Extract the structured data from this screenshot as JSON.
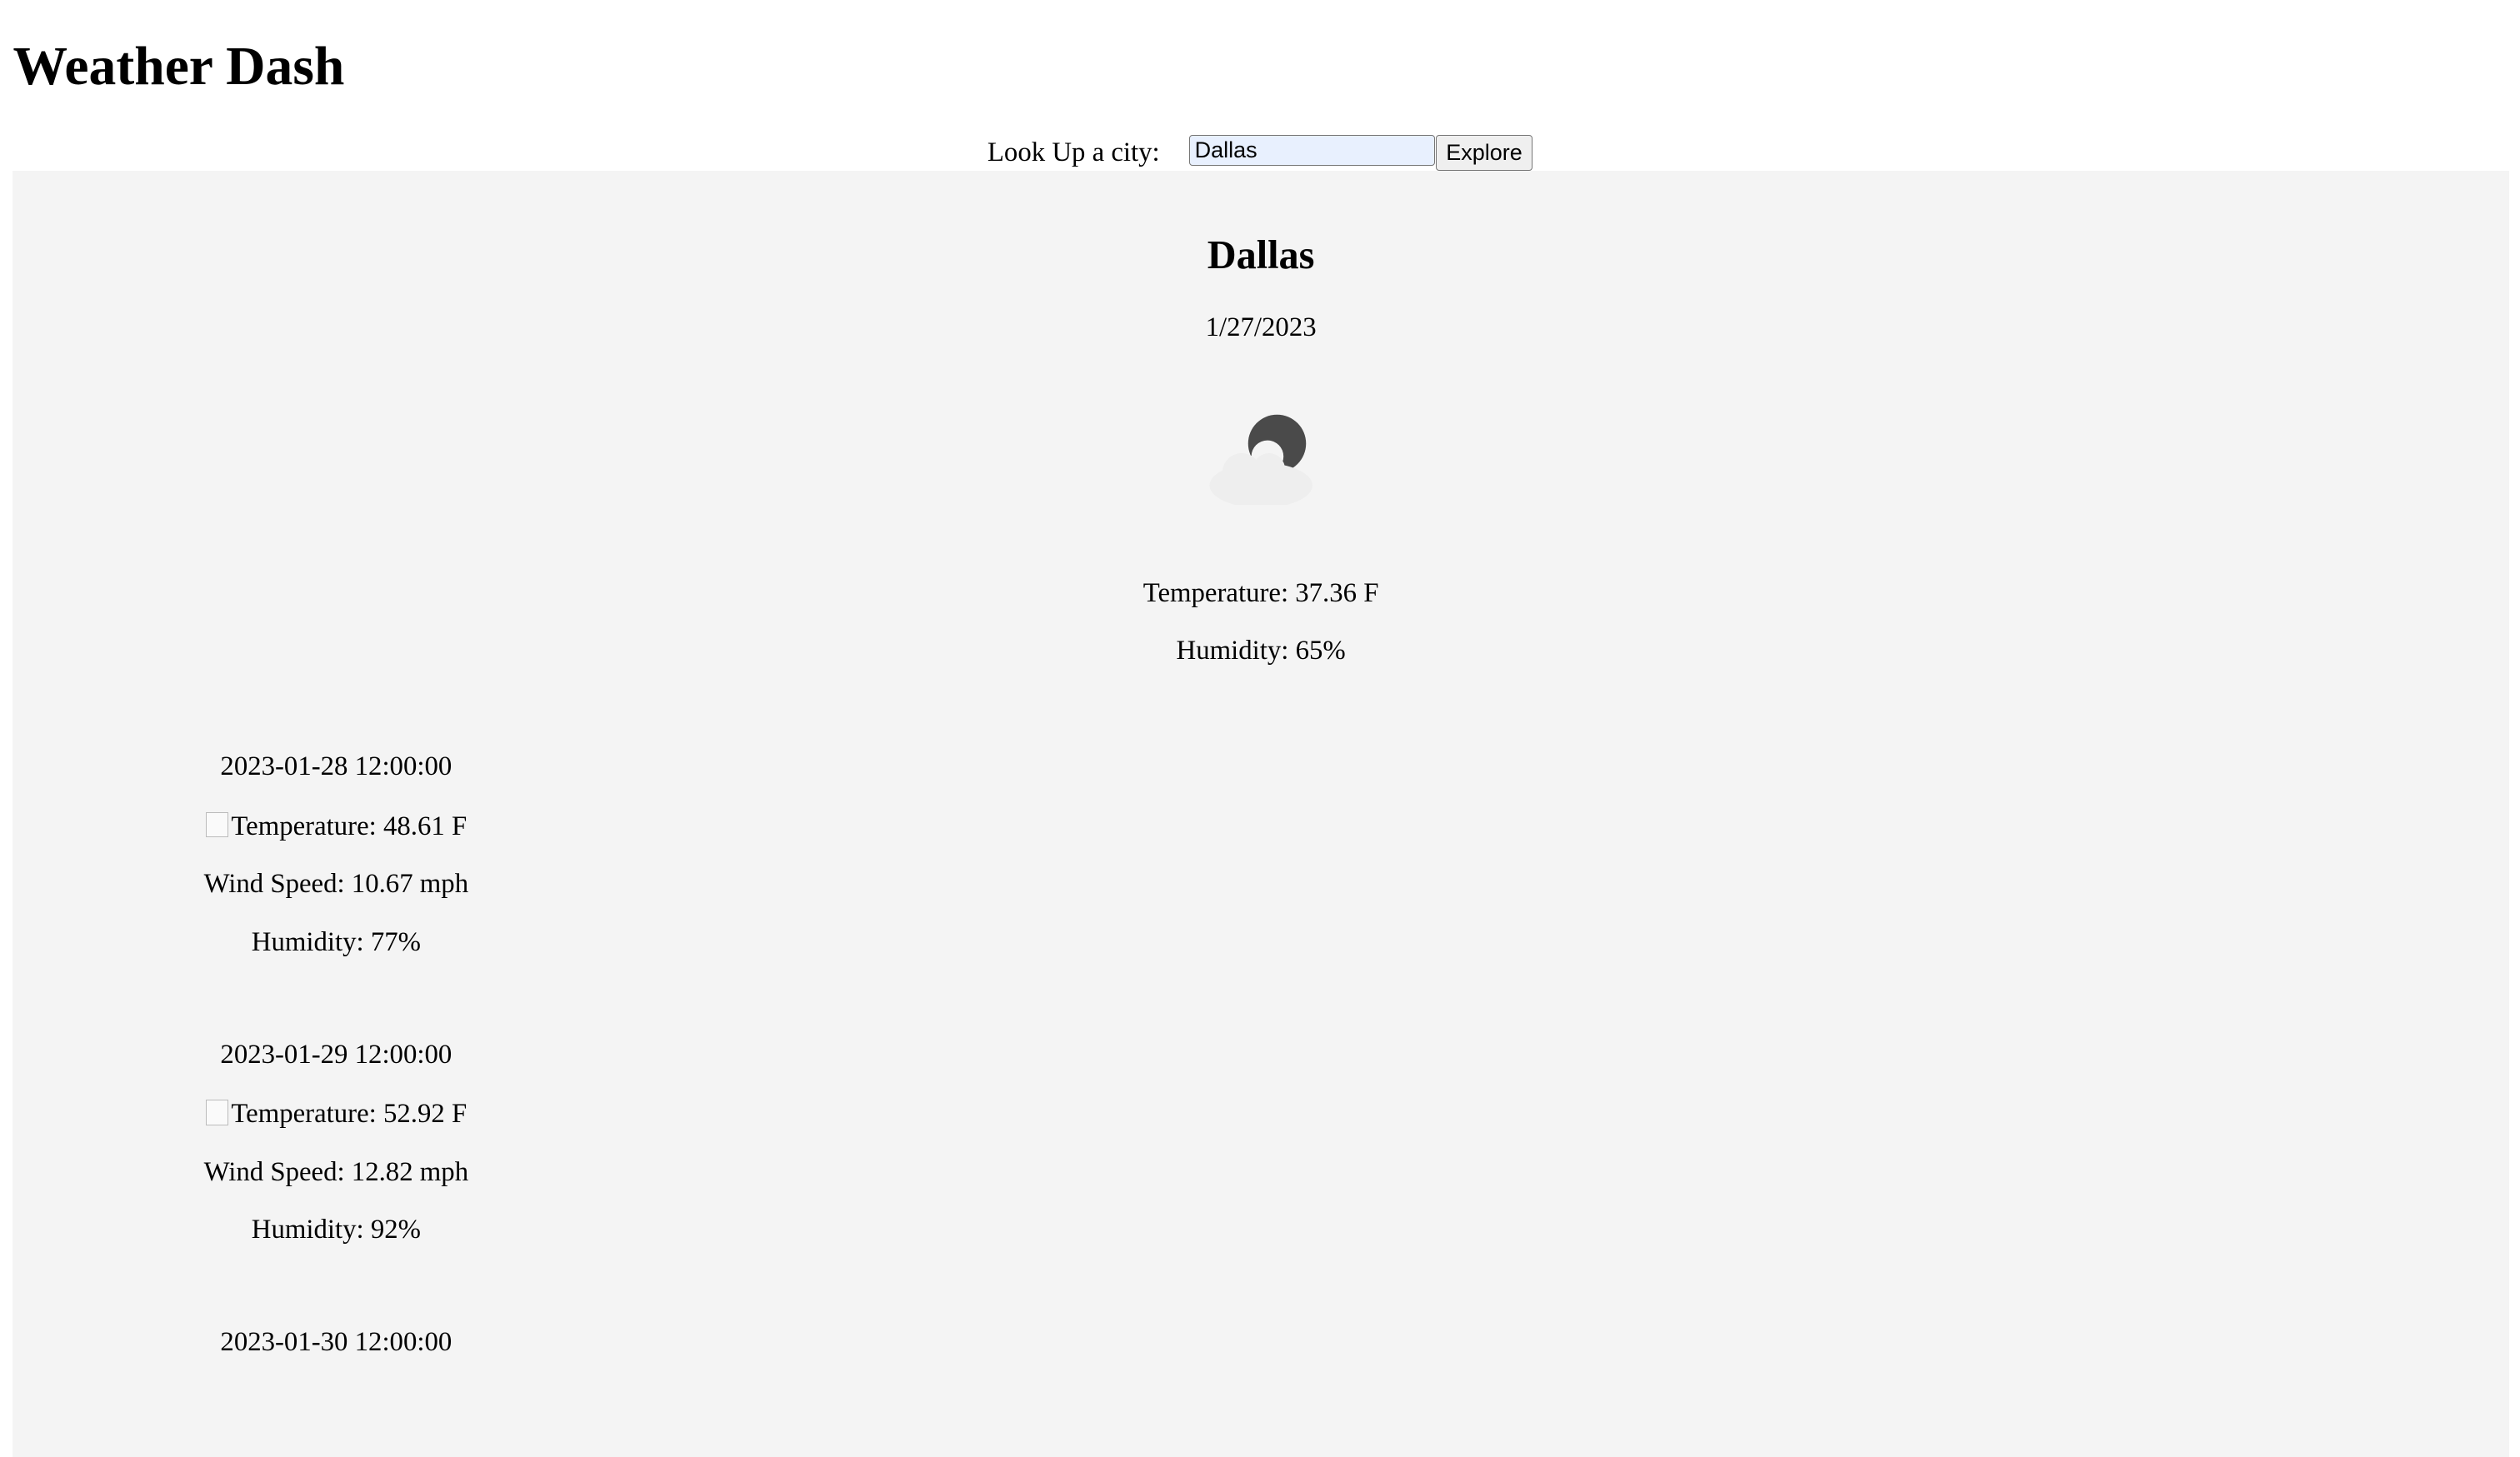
{
  "app": {
    "title": "Weather Dash"
  },
  "search": {
    "label": "Look Up a city:",
    "value": "Dallas",
    "button_label": "Explore"
  },
  "current": {
    "city": "Dallas",
    "date": "1/27/2023",
    "icon": "partly-cloudy-night-icon",
    "temperature": "Temperature: 37.36 F",
    "humidity": "Humidity: 65%"
  },
  "forecast": [
    {
      "date": "2023-01-28 12:00:00",
      "temperature": "Temperature: 48.61 F",
      "wind": "Wind Speed: 10.67 mph",
      "humidity": "Humidity: 77%"
    },
    {
      "date": "2023-01-29 12:00:00",
      "temperature": "Temperature: 52.92 F",
      "wind": "Wind Speed: 12.82 mph",
      "humidity": "Humidity: 92%"
    },
    {
      "date": "2023-01-30 12:00:00"
    }
  ],
  "colors": {
    "panel_bg": "#f4f4f4",
    "input_bg": "#e8f0fe",
    "moon": "#4a4a4a",
    "cloud": "#eeeeee"
  }
}
